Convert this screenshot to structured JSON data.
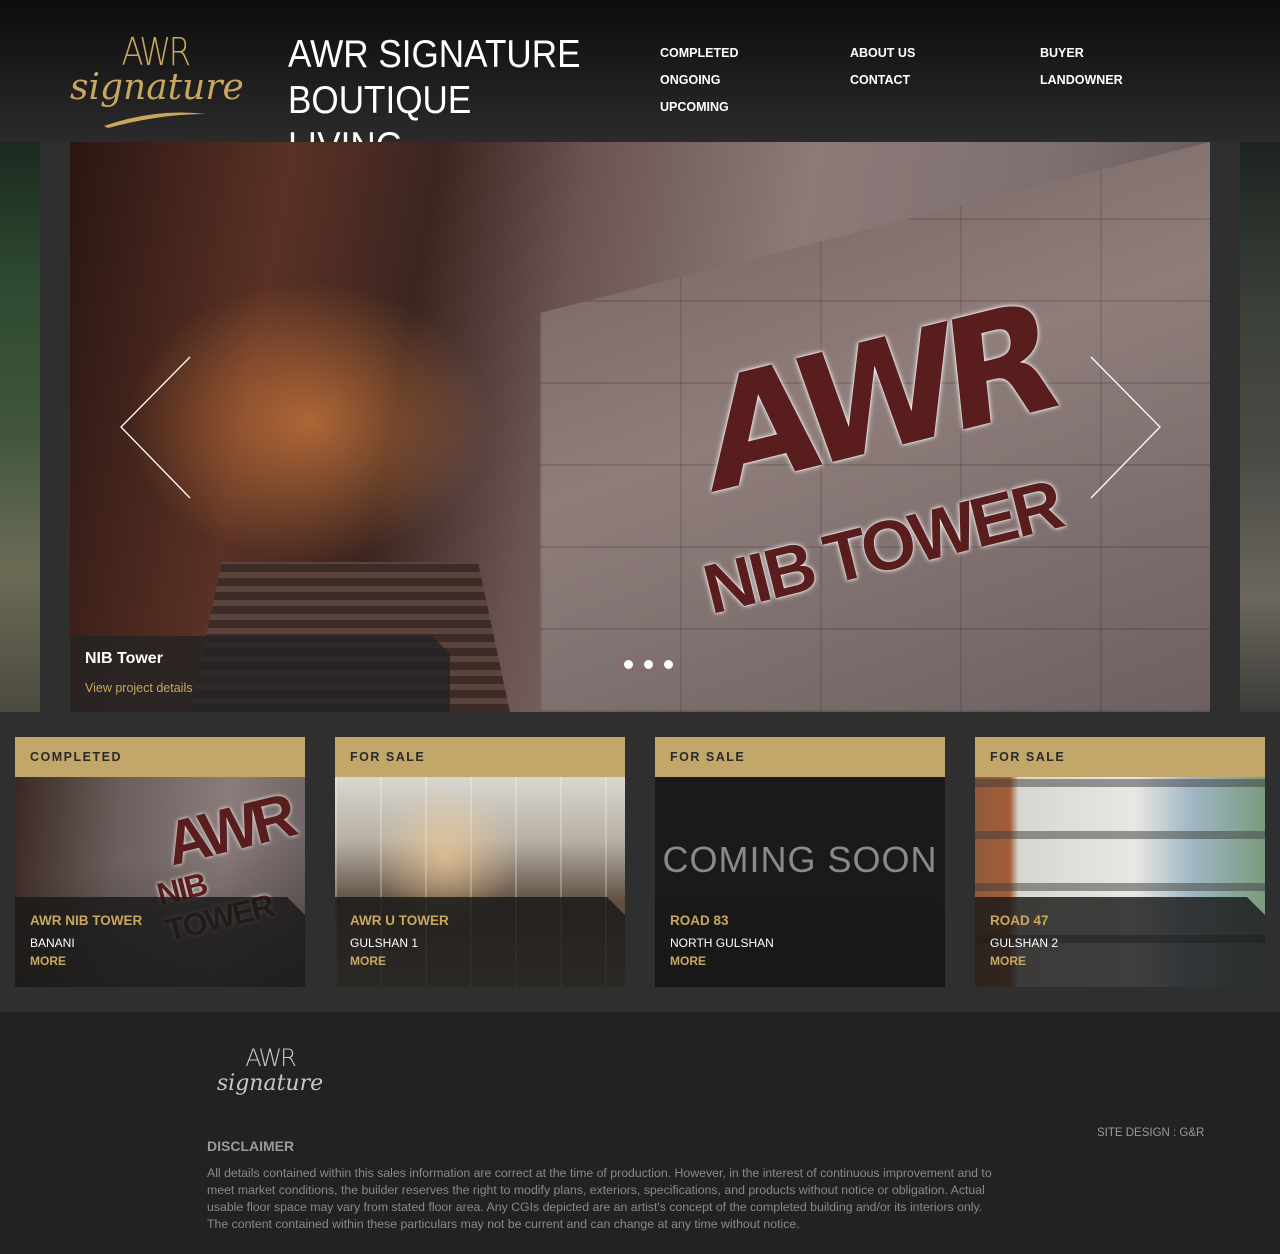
{
  "brand": {
    "logo_awr": "AWR",
    "logo_signature": "signature",
    "title_line1": "AWR SIGNATURE",
    "title_line2": "BOUTIQUE LIVING"
  },
  "nav": {
    "col1": [
      "COMPLETED",
      "ONGOING",
      "UPCOMING"
    ],
    "col2": [
      "ABOUT US",
      "CONTACT"
    ],
    "col3": [
      "BUYER",
      "LANDOWNER"
    ]
  },
  "slider": {
    "slide_sign_main": "AWR",
    "slide_sign_sub": "NIB TOWER",
    "caption_title": "NIB Tower",
    "caption_link": "View project details",
    "dot_count": 4,
    "active_dot": 1
  },
  "cards": [
    {
      "tag": "COMPLETED",
      "name": "AWR NIB TOWER",
      "location": "BANANI",
      "more": "MORE",
      "img_text": "AWR",
      "img_sub": "NIB TOWER"
    },
    {
      "tag": "FOR SALE",
      "name": "AWR U TOWER",
      "location": "GULSHAN 1",
      "more": "MORE"
    },
    {
      "tag": "FOR SALE",
      "name": "ROAD 83",
      "location": "NORTH GULSHAN",
      "more": "MORE",
      "placeholder": "COMING SOON"
    },
    {
      "tag": "FOR SALE",
      "name": "ROAD 47",
      "location": "GULSHAN 2",
      "more": "MORE"
    }
  ],
  "footer": {
    "logo_awr": "AWR",
    "logo_signature": "signature",
    "disclaimer_title": "DISCLAIMER",
    "disclaimer_text": "All details contained within this sales information are correct at the time of production. However, in the interest of continuous improvement and to meet market conditions, the builder reserves the right to modify plans, exteriors, specifications, and products without notice or obligation. Actual usable floor space may vary from stated floor area. Any CGIs depicted are an artist's concept of the completed building and/or its interiors only. The content contained within these particulars may not be current and can change at any time without notice.",
    "site_design": "SITE DESIGN : G&R"
  },
  "colors": {
    "accent_gold": "#c3a66a",
    "gold_text": "#c9a75f",
    "background": "#2f2f2f"
  }
}
